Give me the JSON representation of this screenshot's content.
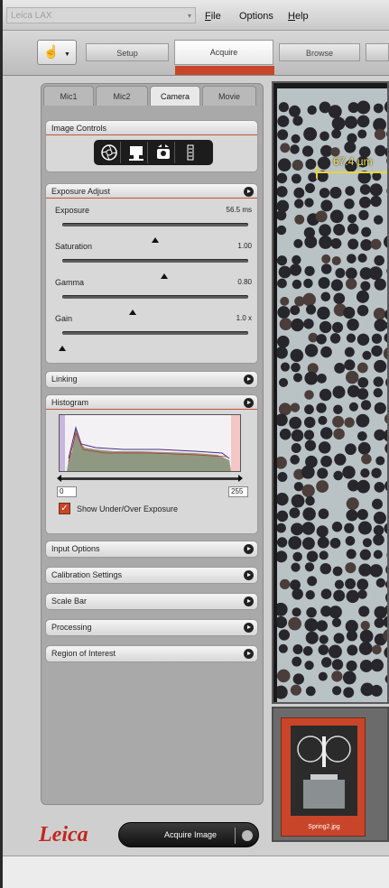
{
  "window": {
    "app_title": "Leica LAX",
    "menus": [
      {
        "label": "File",
        "underline": "F",
        "rest": "ile"
      },
      {
        "label": "Options",
        "underline": "",
        "rest": "Options"
      },
      {
        "label": "Help",
        "underline": "H",
        "rest": "elp"
      }
    ]
  },
  "workflow_tabs": {
    "setup": "Setup",
    "acquire": "Acquire",
    "browse": "Browse",
    "active": "Acquire"
  },
  "sub_tabs": [
    "Mic1",
    "Mic2",
    "Camera",
    "Movie"
  ],
  "sub_tabs_active": "Camera",
  "image_controls": {
    "title": "Image Controls",
    "icons": [
      "aperture-icon",
      "camera-mount-icon",
      "camera-flip-icon",
      "rotate-icon"
    ]
  },
  "exposure_adjust": {
    "title": "Exposure Adjust",
    "params": [
      {
        "label": "Exposure",
        "value": "56.5 ms",
        "level": 0.5
      },
      {
        "label": "Saturation",
        "value": "1.00",
        "level": 0.55
      },
      {
        "label": "Gamma",
        "value": "0.80",
        "level": 0.38
      },
      {
        "label": "Gain",
        "value": "1.0 x",
        "level": 0.0
      }
    ]
  },
  "linking": {
    "title": "Linking"
  },
  "histogram": {
    "title": "Histogram",
    "range_min": "0",
    "range_max": "255",
    "checkbox_label": "Show Under/Over Exposure",
    "checkbox_checked": true
  },
  "collapsed_groups": [
    {
      "title": "Input Options"
    },
    {
      "title": "Calibration Settings"
    },
    {
      "title": "Scale Bar"
    },
    {
      "title": "Processing"
    },
    {
      "title": "Region of Interest"
    }
  ],
  "footer": {
    "brand": "Leica",
    "acquire_button": "Acquire Image"
  },
  "viewer": {
    "measurement": "67.4 µm"
  },
  "filmstrip": {
    "items": [
      {
        "caption": "Spring2.jpg",
        "selected": true
      }
    ]
  },
  "colors": {
    "accent": "#c8452a",
    "brand_red": "#c0281e",
    "measure_yellow": "#e9d63a"
  }
}
